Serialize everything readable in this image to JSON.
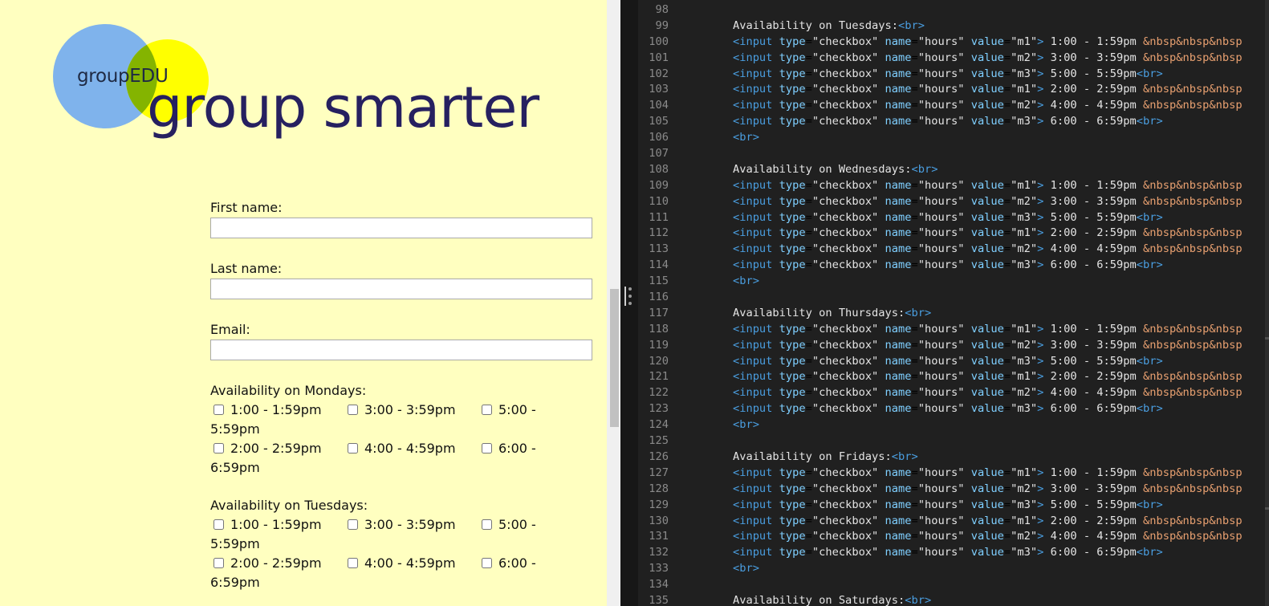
{
  "preview": {
    "logo": {
      "brand": "groupEDU",
      "slogan": "group smarter"
    },
    "fields": [
      {
        "label": "First name:",
        "value": ""
      },
      {
        "label": "Last name:",
        "value": ""
      },
      {
        "label": "Email:",
        "value": ""
      }
    ],
    "days": [
      {
        "title": "Availability on Mondays:",
        "row1": [
          "1:00 - 1:59pm",
          "3:00 - 3:59pm",
          "5:00 -"
        ],
        "wrap1": "5:59pm",
        "row2": [
          "2:00 - 2:59pm",
          "4:00 - 4:59pm",
          "6:00 -"
        ],
        "wrap2": "6:59pm"
      },
      {
        "title": "Availability on Tuesdays:",
        "row1": [
          "1:00 - 1:59pm",
          "3:00 - 3:59pm",
          "5:00 -"
        ],
        "wrap1": "5:59pm",
        "row2": [
          "2:00 - 2:59pm",
          "4:00 - 4:59pm",
          "6:00 -"
        ],
        "wrap2": "6:59pm"
      }
    ]
  },
  "editor": {
    "line_numbers": [
      "98",
      "99",
      "100",
      "101",
      "102",
      "103",
      "104",
      "105",
      "106",
      "107",
      "108",
      "109",
      "110",
      "111",
      "112",
      "113",
      "114",
      "115",
      "116",
      "117",
      "118",
      "119",
      "120",
      "121",
      "122",
      "123",
      "124",
      "125",
      "126",
      "127",
      "128",
      "129",
      "130",
      "131",
      "132",
      "133",
      "134",
      "135"
    ],
    "tokens": {
      "br": "<br>",
      "input_open": "<input",
      "type_attr": "type",
      "checkbox_val": "\"checkbox\"",
      "name_attr": "name",
      "hours_val": "\"hours\"",
      "value_attr": "value",
      "m1": "\"m1\"",
      "m2": "\"m2\"",
      "m3": "\"m3\"",
      "close": ">",
      "nbsp": "&nbsp&nbsp&nbsp"
    },
    "headings": {
      "tue": "Availability on Tuesdays:",
      "wed": "Availability on Wednesdays:",
      "thu": "Availability on Thursdays:",
      "fri": "Availability on Fridays:",
      "sat": "Availability on Saturdays:"
    },
    "times": [
      "1:00 - 1:59pm",
      "3:00 - 3:59pm",
      "5:00 - 5:59pm",
      "2:00 - 2:59pm",
      "4:00 - 4:59pm",
      "6:00 - 6:59pm"
    ]
  },
  "colors": {
    "preview_bg": "#ffffc0",
    "logo_blue": "#7fb3ec",
    "logo_yellow": "#ffff00",
    "logo_overlap": "#84b400",
    "slogan": "#262060",
    "editor_bg": "#202020",
    "tag": "#4a9ee0",
    "attribute": "#7fcfff",
    "entity": "#e8a070"
  }
}
